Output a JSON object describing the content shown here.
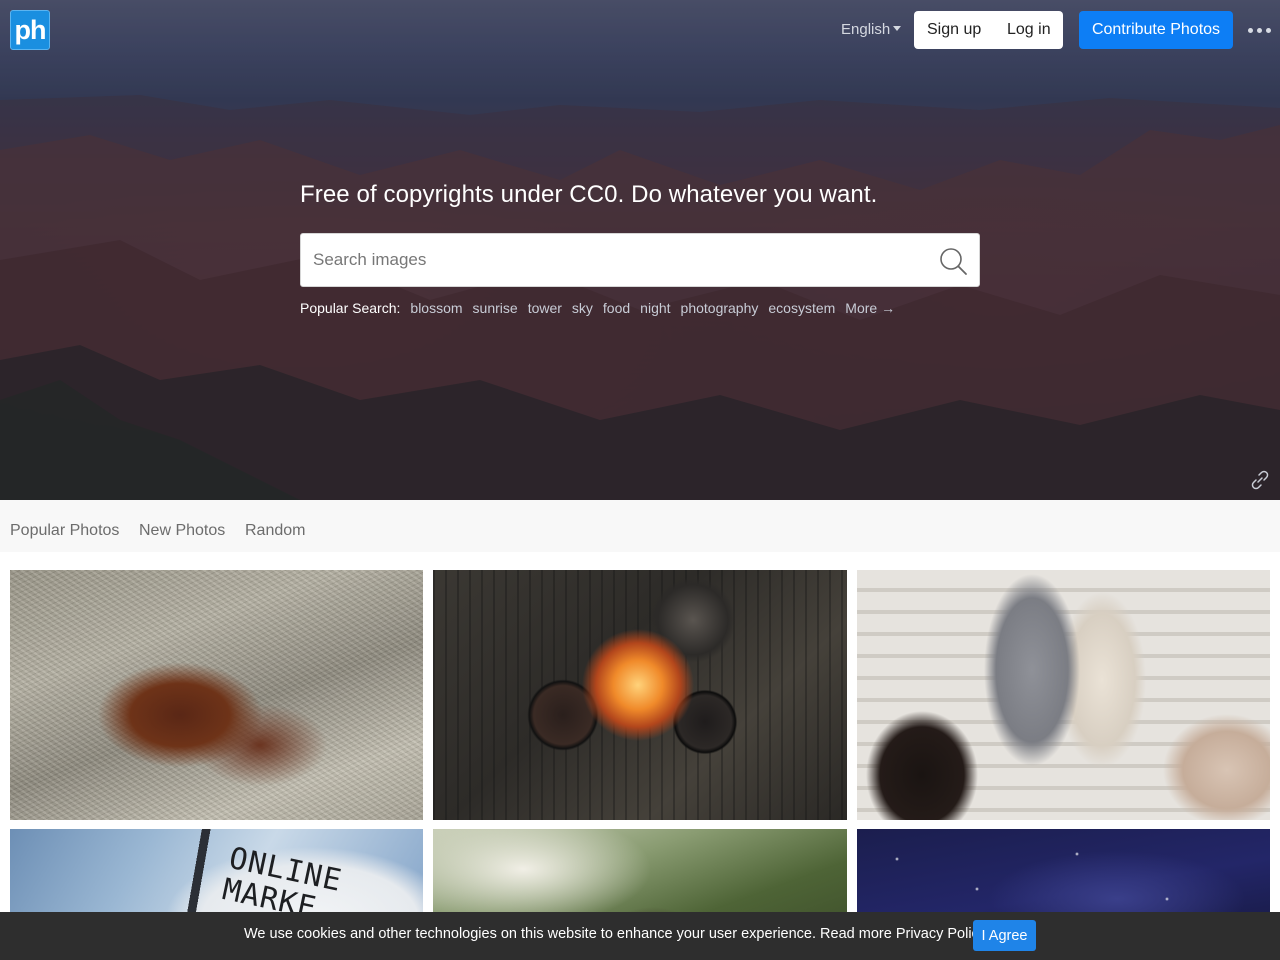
{
  "header": {
    "logo_text": "ph",
    "language": "English",
    "signup_label": "Sign up",
    "login_label": "Log in",
    "contribute_label": "Contribute Photos"
  },
  "hero": {
    "tagline": "Free of copyrights under CC0. Do whatever you want.",
    "search_placeholder": "Search images",
    "popular_label": "Popular Search:",
    "popular_tags": [
      "blossom",
      "sunrise",
      "tower",
      "sky",
      "food",
      "night",
      "photography",
      "ecosystem"
    ],
    "more_label": "More →"
  },
  "tabs": [
    "Popular Photos",
    "New Photos",
    "Random"
  ],
  "photos": {
    "overlay_text": "ONLINE\nMARKE"
  },
  "cookie": {
    "message": "We use cookies and other technologies on this website to enhance your user experience. Read more Privacy Policy.",
    "agree_label": "I Agree"
  },
  "colors": {
    "primary": "#0d7ef5",
    "logo_bg": "#1a8fe0",
    "cookie_bg": "#2e2e2e",
    "tab_bar_bg": "#f8f8f8"
  }
}
